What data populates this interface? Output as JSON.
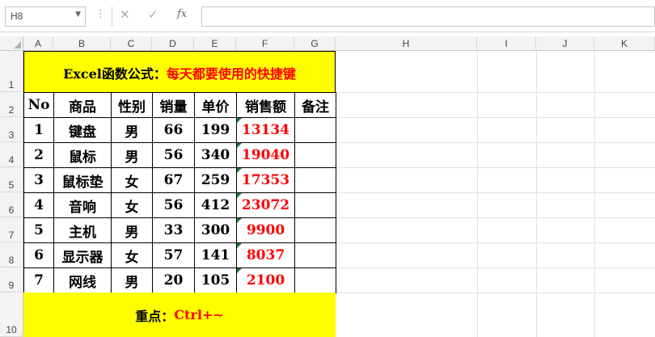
{
  "formula_bar": {
    "name_box": "H8",
    "cancel_icon": "✕",
    "enter_icon": "✓",
    "fx_label": "fx",
    "formula": ""
  },
  "columns": [
    "A",
    "B",
    "C",
    "D",
    "E",
    "F",
    "G",
    "H",
    "I",
    "J",
    "K"
  ],
  "rows": [
    "1",
    "2",
    "3",
    "4",
    "5",
    "6",
    "7",
    "8",
    "9",
    "10"
  ],
  "sheet": {
    "title_black": "Excel函数公式：",
    "title_red": "每天都要使用的快捷键",
    "headers": [
      "No",
      "商品",
      "性别",
      "销量",
      "单价",
      "销售额",
      "备注"
    ],
    "records": [
      [
        "1",
        "键盘",
        "男",
        "66",
        "199",
        "13134",
        ""
      ],
      [
        "2",
        "鼠标",
        "男",
        "56",
        "340",
        "19040",
        ""
      ],
      [
        "3",
        "鼠标垫",
        "女",
        "67",
        "259",
        "17353",
        ""
      ],
      [
        "4",
        "音响",
        "女",
        "56",
        "412",
        "23072",
        ""
      ],
      [
        "5",
        "主机",
        "男",
        "33",
        "300",
        "9900",
        ""
      ],
      [
        "6",
        "显示器",
        "女",
        "57",
        "141",
        "8037",
        ""
      ],
      [
        "7",
        "网线",
        "男",
        "20",
        "105",
        "2100",
        ""
      ]
    ],
    "footer_black": "重点：",
    "footer_red": "Ctrl+~"
  },
  "colors": {
    "highlight": "#ffff00",
    "accent_text": "#ff0000",
    "error_indicator": "#1e7a3c"
  }
}
